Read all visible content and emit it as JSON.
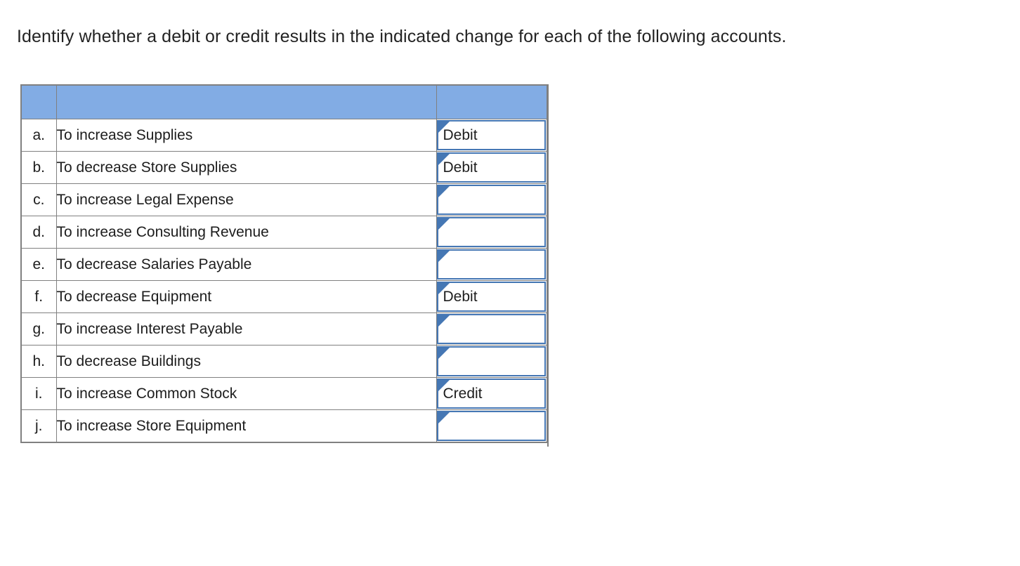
{
  "prompt": "Identify whether a debit or credit results in the indicated change for each of the following accounts.",
  "table": {
    "header": {
      "letter_col": "",
      "desc_col": "",
      "answer_col": ""
    },
    "answer_options": [
      "Debit",
      "Credit"
    ],
    "rows": [
      {
        "letter": "a.",
        "description": "To increase Supplies",
        "answer": "Debit"
      },
      {
        "letter": "b.",
        "description": "To decrease Store Supplies",
        "answer": "Debit"
      },
      {
        "letter": "c.",
        "description": "To increase Legal Expense",
        "answer": ""
      },
      {
        "letter": "d.",
        "description": "To increase Consulting Revenue",
        "answer": ""
      },
      {
        "letter": "e.",
        "description": "To decrease Salaries Payable",
        "answer": ""
      },
      {
        "letter": "f.",
        "description": "To decrease Equipment",
        "answer": "Debit"
      },
      {
        "letter": "g.",
        "description": "To increase Interest Payable",
        "answer": ""
      },
      {
        "letter": "h.",
        "description": "To decrease Buildings",
        "answer": ""
      },
      {
        "letter": "i.",
        "description": "To increase Common Stock",
        "answer": "Credit"
      },
      {
        "letter": "j.",
        "description": "To increase Store Equipment",
        "answer": ""
      }
    ]
  },
  "colors": {
    "header_fill": "#82ace4",
    "grid_line": "#808080",
    "dropdown_border": "#4577b4",
    "text": "#1d1d1d"
  }
}
